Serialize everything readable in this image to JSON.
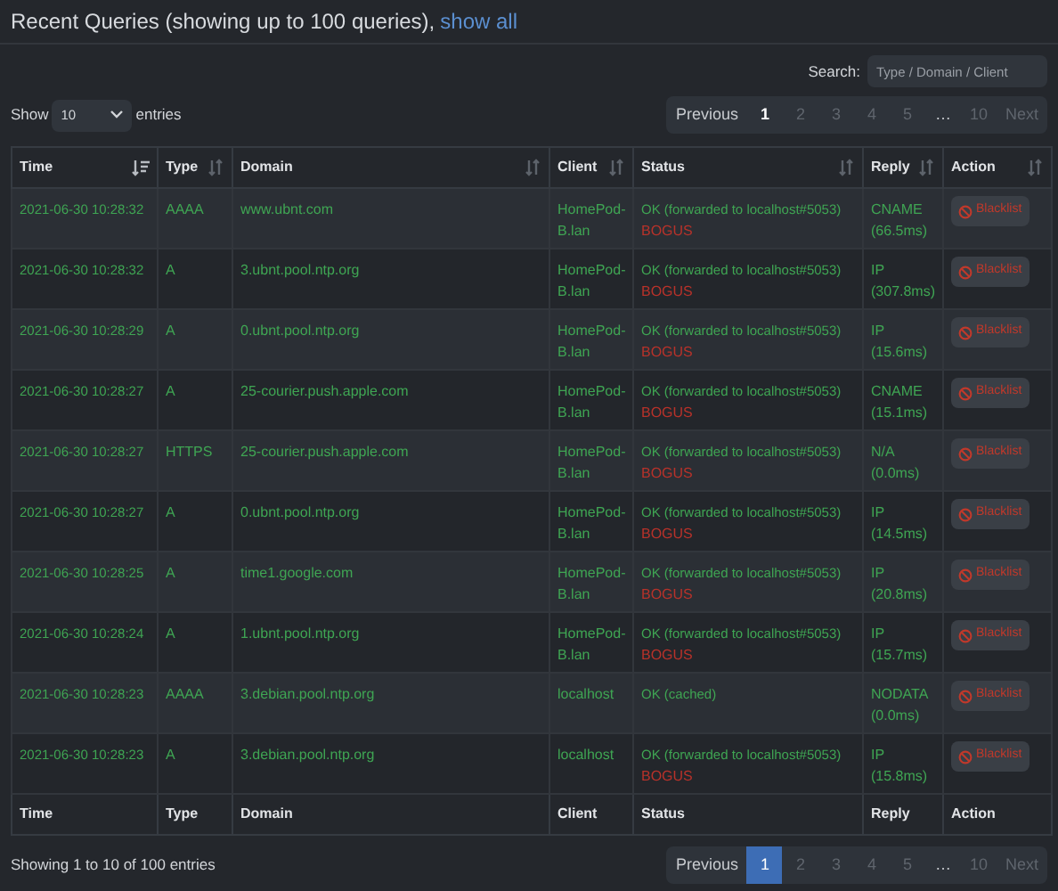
{
  "header": {
    "title": "Recent Queries (showing up to 100 queries),",
    "link": "show all"
  },
  "search": {
    "label": "Search:",
    "placeholder": "Type / Domain / Client"
  },
  "length": {
    "before": "Show",
    "value": "10",
    "after": "entries"
  },
  "pagination_top": {
    "kind": "plain",
    "previous": "Previous",
    "next": "Next",
    "pages": [
      {
        "label": "1",
        "selected": true
      },
      {
        "label": "2",
        "selected": false
      },
      {
        "label": "3",
        "selected": false
      },
      {
        "label": "4",
        "selected": false
      },
      {
        "label": "5",
        "selected": false
      },
      {
        "label": "…",
        "selected": false
      },
      {
        "label": "10",
        "selected": false
      }
    ]
  },
  "table": {
    "columns": [
      {
        "label": "Time",
        "sorted": true
      },
      {
        "label": "Type",
        "sorted": false
      },
      {
        "label": "Domain",
        "sorted": false
      },
      {
        "label": "Client",
        "sorted": false
      },
      {
        "label": "Status",
        "sorted": false
      },
      {
        "label": "Reply",
        "sorted": false
      },
      {
        "label": "Action",
        "sorted": false
      }
    ],
    "rows": [
      {
        "time": "2021-06-30 10:28:32",
        "type": "AAAA",
        "domain": "www.ubnt.com",
        "client": "HomePod-B.lan",
        "status": "OK (forwarded to localhost#5053)",
        "flag": "BOGUS",
        "reply": "CNAME (66.5ms)",
        "action": "Blacklist"
      },
      {
        "time": "2021-06-30 10:28:32",
        "type": "A",
        "domain": "3.ubnt.pool.ntp.org",
        "client": "HomePod-B.lan",
        "status": "OK (forwarded to localhost#5053)",
        "flag": "BOGUS",
        "reply": "IP (307.8ms)",
        "action": "Blacklist"
      },
      {
        "time": "2021-06-30 10:28:29",
        "type": "A",
        "domain": "0.ubnt.pool.ntp.org",
        "client": "HomePod-B.lan",
        "status": "OK (forwarded to localhost#5053)",
        "flag": "BOGUS",
        "reply": "IP (15.6ms)",
        "action": "Blacklist"
      },
      {
        "time": "2021-06-30 10:28:27",
        "type": "A",
        "domain": "25-courier.push.apple.com",
        "client": "HomePod-B.lan",
        "status": "OK (forwarded to localhost#5053)",
        "flag": "BOGUS",
        "reply": "CNAME (15.1ms)",
        "action": "Blacklist"
      },
      {
        "time": "2021-06-30 10:28:27",
        "type": "HTTPS",
        "domain": "25-courier.push.apple.com",
        "client": "HomePod-B.lan",
        "status": "OK (forwarded to localhost#5053)",
        "flag": "BOGUS",
        "reply": "N/A (0.0ms)",
        "action": "Blacklist"
      },
      {
        "time": "2021-06-30 10:28:27",
        "type": "A",
        "domain": "0.ubnt.pool.ntp.org",
        "client": "HomePod-B.lan",
        "status": "OK (forwarded to localhost#5053)",
        "flag": "BOGUS",
        "reply": "IP (14.5ms)",
        "action": "Blacklist"
      },
      {
        "time": "2021-06-30 10:28:25",
        "type": "A",
        "domain": "time1.google.com",
        "client": "HomePod-B.lan",
        "status": "OK (forwarded to localhost#5053)",
        "flag": "BOGUS",
        "reply": "IP (20.8ms)",
        "action": "Blacklist"
      },
      {
        "time": "2021-06-30 10:28:24",
        "type": "A",
        "domain": "1.ubnt.pool.ntp.org",
        "client": "HomePod-B.lan",
        "status": "OK (forwarded to localhost#5053)",
        "flag": "BOGUS",
        "reply": "IP (15.7ms)",
        "action": "Blacklist"
      },
      {
        "time": "2021-06-30 10:28:23",
        "type": "AAAA",
        "domain": "3.debian.pool.ntp.org",
        "client": "localhost",
        "status": "OK (cached)",
        "reply": "NODATA (0.0ms)",
        "action": "Blacklist"
      },
      {
        "time": "2021-06-30 10:28:23",
        "type": "A",
        "domain": "3.debian.pool.ntp.org",
        "client": "localhost",
        "status": "OK (forwarded to localhost#5053)",
        "flag": "BOGUS",
        "reply": "IP (15.8ms)",
        "action": "Blacklist"
      }
    ],
    "footer": [
      "Time",
      "Type",
      "Domain",
      "Client",
      "Status",
      "Reply",
      "Action"
    ]
  },
  "info": "Showing 1 to 10 of 100 entries",
  "pagination_bottom": {
    "kind": "filled",
    "previous": "Previous",
    "next": "Next",
    "pages": [
      {
        "label": "1",
        "selected": true
      },
      {
        "label": "2",
        "selected": false
      },
      {
        "label": "3",
        "selected": false
      },
      {
        "label": "4",
        "selected": false
      },
      {
        "label": "5",
        "selected": false
      },
      {
        "label": "…",
        "selected": false
      },
      {
        "label": "10",
        "selected": false
      }
    ]
  }
}
